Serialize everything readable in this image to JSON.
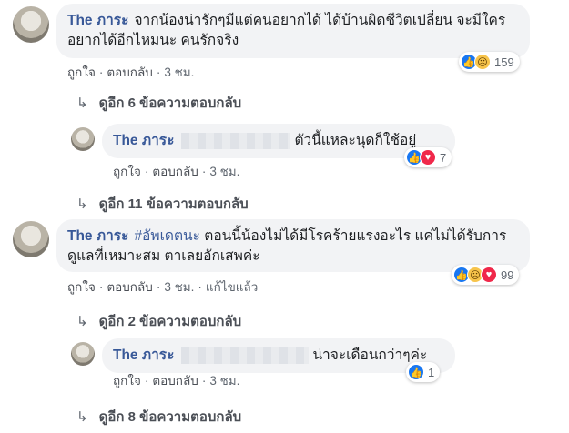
{
  "c1": {
    "author": "The ภาระ",
    "text": "จากน้องน่ารักๆมีแต่คนอยากได้ ได้บ้านผิดชีวิตเปลี่ยน จะมีใครอยากได้อีกไหมนะ คนรักจริง",
    "like": "ถูกใจ",
    "reply": "ตอบกลับ",
    "time": "3 ชม.",
    "reactions": "159"
  },
  "more1": "ดูอีก 6 ข้อความตอบกลับ",
  "r1": {
    "author": "The ภาระ",
    "text": "ตัวนี้แหละนุดก็ใช้อยู่",
    "like": "ถูกใจ",
    "reply": "ตอบกลับ",
    "time": "3 ชม.",
    "reactions": "7"
  },
  "more2": "ดูอีก 11 ข้อความตอบกลับ",
  "c2": {
    "author": "The ภาระ",
    "hashtag": "#อัพเดตนะ",
    "text": "ตอนนี้น้องไม่ได้มีโรคร้ายแรงอะไร แค่ไม่ได้รับการดูแลที่เหมาะสม ตาเลยอักเสพค่ะ",
    "like": "ถูกใจ",
    "reply": "ตอบกลับ",
    "time": "3 ชม.",
    "edited": "แก้ไขแล้ว",
    "reactions": "99"
  },
  "more3": "ดูอีก 2 ข้อความตอบกลับ",
  "r2": {
    "author": "The ภาระ",
    "text": "น่าจะเดือนกว่าๆค่ะ",
    "like": "ถูกใจ",
    "reply": "ตอบกลับ",
    "time": "3 ชม.",
    "reactions": "1"
  },
  "more4": "ดูอีก 8 ข้อความตอบกลับ",
  "icons": {
    "like": "like-icon",
    "sad": "sad-icon",
    "love": "love-icon",
    "reply_arrow": "reply-arrow-icon"
  },
  "colors": {
    "author": "#385898",
    "bubble": "#f2f3f5",
    "like": "#1877f2",
    "love": "#f0284a"
  }
}
